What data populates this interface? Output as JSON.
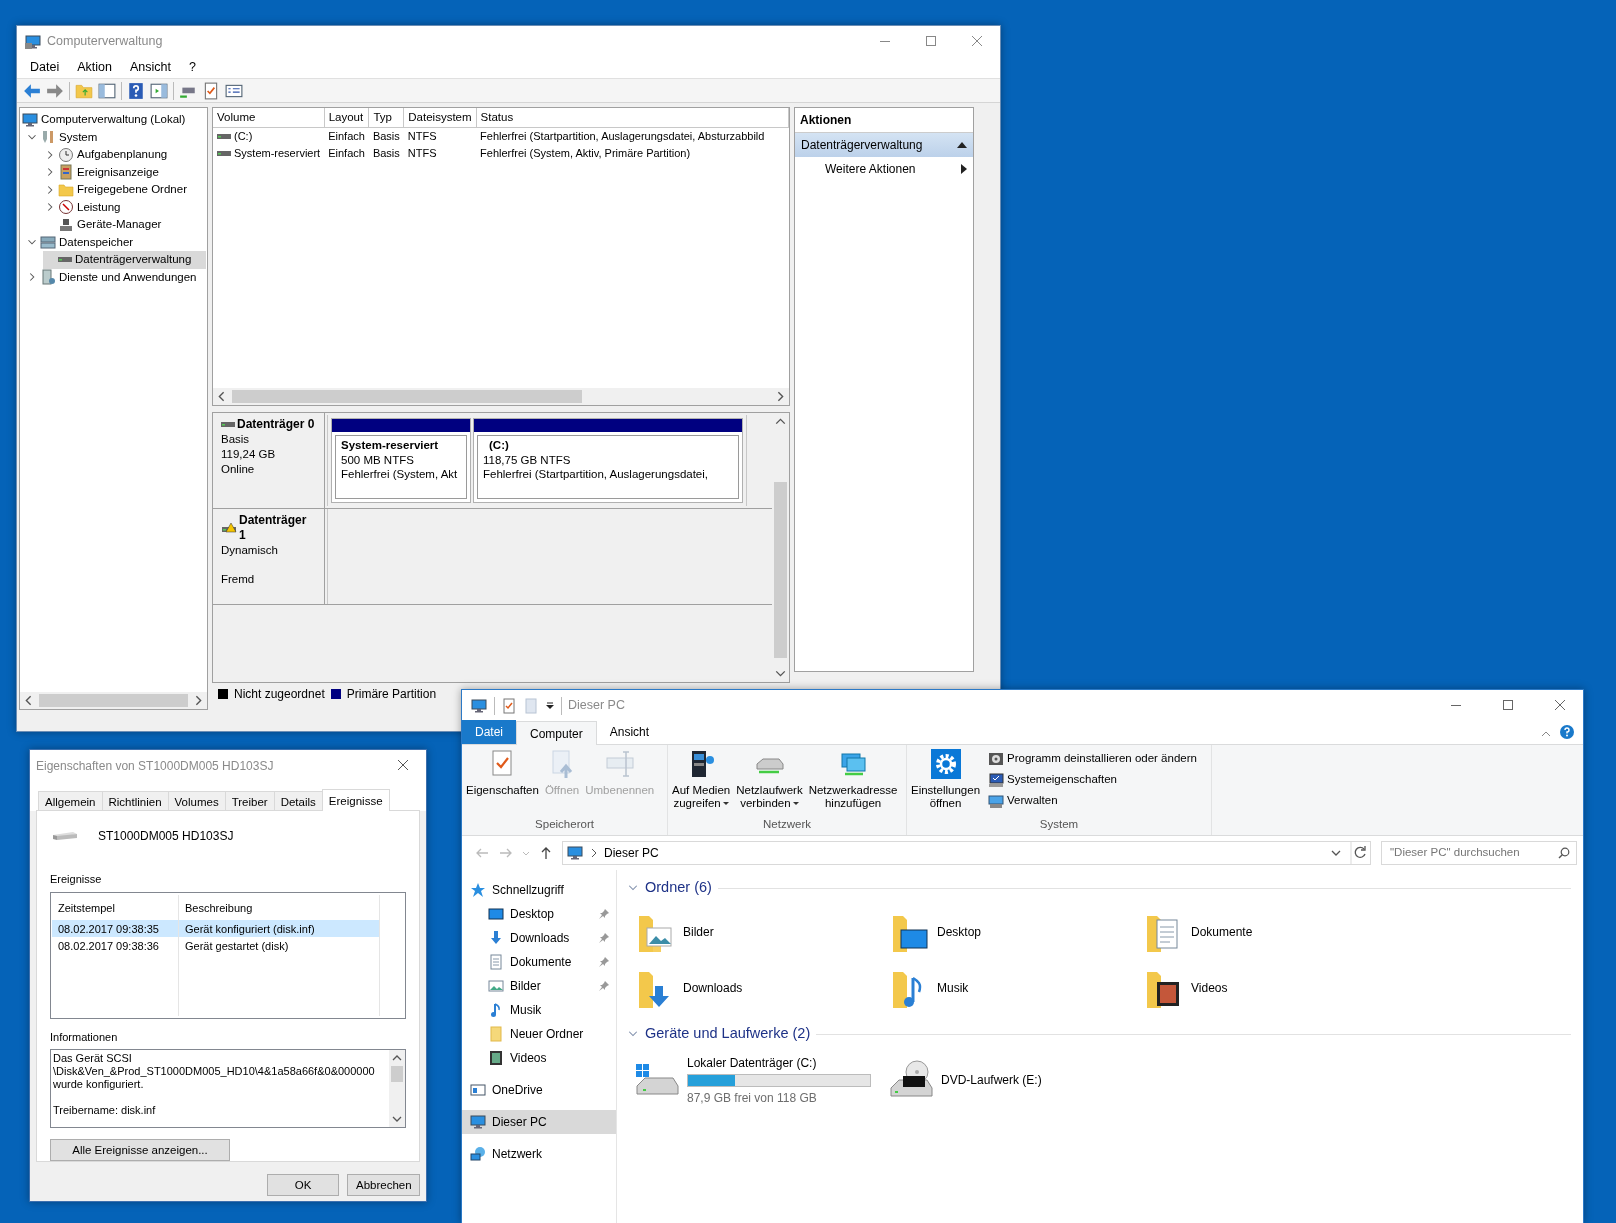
{
  "computer_management": {
    "title": "Computerverwaltung",
    "menu": [
      "Datei",
      "Aktion",
      "Ansicht",
      "?"
    ],
    "tree": [
      {
        "label": "Computerverwaltung (Lokal)",
        "selected": false,
        "children": [
          {
            "label": "System",
            "expanded": true,
            "selected": false,
            "children": [
              {
                "label": "Aufgabenplanung",
                "expanded": false,
                "selected": false
              },
              {
                "label": "Ereignisanzeige",
                "expanded": false,
                "selected": false
              },
              {
                "label": "Freigegebene Ordner",
                "expanded": false,
                "selected": false
              },
              {
                "label": "Leistung",
                "expanded": false,
                "selected": false
              },
              {
                "label": "Geräte-Manager",
                "selected": false
              }
            ]
          },
          {
            "label": "Datenspeicher",
            "expanded": true,
            "selected": false,
            "children": [
              {
                "label": "Datenträgerverwaltung",
                "selected": true
              }
            ]
          },
          {
            "label": "Dienste und Anwendungen",
            "expanded": false,
            "selected": false
          }
        ]
      }
    ],
    "volumes": {
      "columns": [
        "Volume",
        "Layout",
        "Typ",
        "Dateisystem",
        "Status"
      ],
      "rows": [
        [
          "(C:)",
          "Einfach",
          "Basis",
          "NTFS",
          "Fehlerfrei (Startpartition, Auslagerungsdatei, Absturzabbild"
        ],
        [
          "System-reserviert",
          "Einfach",
          "Basis",
          "NTFS",
          "Fehlerfrei (System, Aktiv, Primäre Partition)"
        ]
      ]
    },
    "disks": [
      {
        "name": "Datenträger 0",
        "warning": false,
        "type": "Basis",
        "size": "119,24 GB",
        "state": "Online",
        "partitions": [
          {
            "name": "System-reserviert",
            "size": "500 MB NTFS",
            "status": "Fehlerfrei (System, Akt"
          },
          {
            "name": "(C:)",
            "size": "118,75 GB NTFS",
            "status": "Fehlerfrei (Startpartition, Auslagerungsdatei,"
          }
        ]
      },
      {
        "name": "Datenträger 1",
        "warning": true,
        "type": "Dynamisch",
        "state": "Fremd"
      }
    ],
    "legend": [
      {
        "label": "Nicht zugeordnet",
        "color": "#000000"
      },
      {
        "label": "Primäre Partition",
        "color": "#000080"
      }
    ],
    "actions": {
      "title": "Aktionen",
      "section": "Datenträgerverwaltung",
      "expanded": true,
      "items": [
        "Weitere Aktionen"
      ]
    }
  },
  "properties_dialog": {
    "title": "Eigenschaften von ST1000DM005 HD103SJ",
    "tabs": [
      {
        "label": "Allgemein",
        "selected": false
      },
      {
        "label": "Richtlinien",
        "selected": false
      },
      {
        "label": "Volumes",
        "selected": false
      },
      {
        "label": "Treiber",
        "selected": false
      },
      {
        "label": "Details",
        "selected": false
      },
      {
        "label": "Ereignisse",
        "selected": true
      }
    ],
    "device_name": "ST1000DM005 HD103SJ",
    "events_label": "Ereignisse",
    "events_table": {
      "columns": [
        "Zeitstempel",
        "Beschreibung"
      ],
      "rows": [
        {
          "timestamp": "08.02.2017 09:38:35",
          "description": "Gerät konfiguriert (disk.inf)",
          "selected": true
        },
        {
          "timestamp": "08.02.2017 09:38:36",
          "description": "Gerät gestartet (disk)",
          "selected": false
        }
      ]
    },
    "info_label": "Informationen",
    "info_text": "Das Gerät SCSI\n\\Disk&Ven_&Prod_ST1000DM005_HD10\\4&1a58a66f&0&000000\nwurde konfiguriert.\n\nTreibername: disk.inf",
    "buttons": [
      "Alle Ereignisse anzeigen...",
      "OK",
      "Abbrechen"
    ]
  },
  "explorer": {
    "title": "Dieser PC",
    "ribbon_tabs": [
      {
        "label": "Datei",
        "kind": "file",
        "selected": false
      },
      {
        "label": "Computer",
        "kind": "tab",
        "selected": true
      },
      {
        "label": "Ansicht",
        "kind": "tab",
        "selected": false
      }
    ],
    "ribbon_groups": [
      {
        "label": "Speicherort",
        "buttons": [
          {
            "label": "Eigenschaften",
            "kind": "large",
            "disabled": false
          },
          {
            "label": "Öffnen",
            "kind": "large",
            "disabled": true
          },
          {
            "label": "Umbenennen",
            "kind": "large",
            "disabled": true
          }
        ]
      },
      {
        "label": "Netzwerk",
        "buttons": [
          {
            "label": "Auf Medien\nzugreifen",
            "kind": "large",
            "disabled": false,
            "dropdown": true
          },
          {
            "label": "Netzlaufwerk\nverbinden",
            "kind": "large",
            "disabled": false,
            "dropdown": true
          },
          {
            "label": "Netzwerkadresse\nhinzufügen",
            "kind": "large",
            "disabled": false,
            "dropdown": false
          }
        ]
      },
      {
        "label": "System",
        "buttons": [
          {
            "label": "Einstellungen\nöffnen",
            "kind": "large",
            "disabled": false,
            "dropdown": false
          },
          {
            "label": "Programm deinstallieren oder ändern",
            "kind": "small",
            "disabled": false
          },
          {
            "label": "Systemeigenschaften",
            "kind": "small",
            "disabled": false
          },
          {
            "label": "Verwalten",
            "kind": "small",
            "disabled": false
          }
        ]
      }
    ],
    "address": "Dieser PC",
    "search": {
      "placeholder": "\"Dieser PC\" durchsuchen"
    },
    "nav": [
      {
        "label": "Schnellzugriff",
        "selected": false,
        "children": [
          {
            "label": "Desktop",
            "pinned": true,
            "selected": false
          },
          {
            "label": "Downloads",
            "pinned": true,
            "selected": false
          },
          {
            "label": "Dokumente",
            "pinned": true,
            "selected": false
          },
          {
            "label": "Bilder",
            "pinned": true,
            "selected": false
          },
          {
            "label": "Musik",
            "pinned": false,
            "selected": false
          },
          {
            "label": "Neuer Ordner",
            "pinned": false,
            "selected": false
          },
          {
            "label": "Videos",
            "pinned": false,
            "selected": false
          }
        ]
      },
      {
        "label": "OneDrive",
        "selected": false
      },
      {
        "label": "Dieser PC",
        "selected": true
      },
      {
        "label": "Netzwerk",
        "selected": false
      }
    ],
    "sections": [
      {
        "title": "Ordner (6)",
        "expanded": true,
        "items": [
          {
            "kind": "folder",
            "label": "Bilder"
          },
          {
            "kind": "folder",
            "label": "Desktop"
          },
          {
            "kind": "folder",
            "label": "Dokumente"
          },
          {
            "kind": "folder",
            "label": "Downloads"
          },
          {
            "kind": "folder",
            "label": "Musik"
          },
          {
            "kind": "folder",
            "label": "Videos"
          }
        ]
      },
      {
        "title": "Geräte und Laufwerke (2)",
        "expanded": true,
        "items": [
          {
            "kind": "drive",
            "label": "Lokaler Datenträger (C:)",
            "level": 0.26,
            "detail": "87,9 GB frei von 118 GB"
          },
          {
            "kind": "optical",
            "label": "DVD-Laufwerk (E:)"
          }
        ]
      }
    ]
  }
}
